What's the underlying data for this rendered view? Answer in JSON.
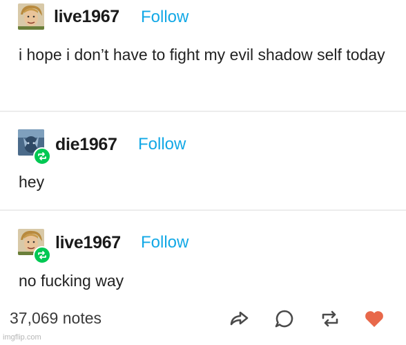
{
  "posts": [
    {
      "username": "live1967",
      "follow_label": "Follow",
      "text": "i hope i don’t have to fight my evil shadow self today"
    },
    {
      "username": "die1967",
      "follow_label": "Follow",
      "text": "hey"
    },
    {
      "username": "live1967",
      "follow_label": "Follow",
      "text": "no fucking way"
    }
  ],
  "footer": {
    "notes_label": "37,069 notes",
    "icons": [
      "share-icon",
      "comment-icon",
      "reblog-icon",
      "heart-icon"
    ],
    "like_color": "#e8684a"
  },
  "watermark": "imgflip.com",
  "colors": {
    "follow": "#12a8e6",
    "reblog_badge": "#00c853"
  }
}
